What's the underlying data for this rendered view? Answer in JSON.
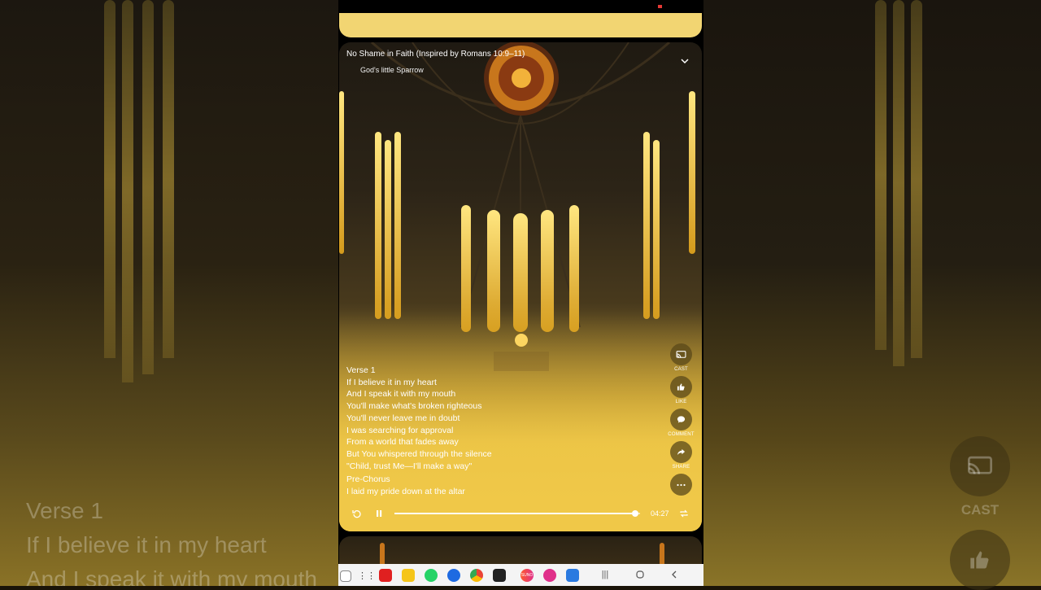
{
  "song": {
    "title": "No Shame in Faith  (Inspired by Romans 10:9–11)",
    "artist": "God's little Sparrow"
  },
  "lyrics": [
    {
      "text": "Verse 1",
      "type": "section"
    },
    {
      "text": "If I believe it in my heart",
      "type": "line"
    },
    {
      "text": "And I speak it with my mouth",
      "type": "line"
    },
    {
      "text": "You'll make what's broken righteous",
      "type": "line"
    },
    {
      "text": "You'll never leave me in doubt",
      "type": "line"
    },
    {
      "text": "I was searching for approval",
      "type": "line"
    },
    {
      "text": "From a world that fades away",
      "type": "line"
    },
    {
      "text": "But You whispered through the silence",
      "type": "line"
    },
    {
      "text": "\"Child, trust Me—I'll make a way\"",
      "type": "line"
    },
    {
      "text": "Pre-Chorus",
      "type": "section"
    },
    {
      "text": "I laid my pride down at the altar",
      "type": "line"
    }
  ],
  "actions": {
    "cast": "CAST",
    "like": "LIKE",
    "comment": "COMMENT",
    "share": "SHARE"
  },
  "player": {
    "duration": "04:27",
    "progress": 0.98,
    "state": "playing"
  },
  "background": {
    "lyric_1": "Verse 1",
    "lyric_2": "If I believe it in my heart",
    "lyric_3": "And I speak it with my mouth",
    "cast_label": "CAST"
  },
  "taskbar": {
    "apps": [
      "screenshot-app",
      "app-drawer",
      "red-app",
      "files-app",
      "whatsapp-app",
      "messages-app",
      "chrome-app",
      "camera-app",
      "suno-app",
      "flower-app",
      "3d-box-app"
    ],
    "suno_label": "SUNO"
  },
  "colors": {
    "card_yellow": "#f2d572",
    "accent_gold": "#e7c044"
  }
}
